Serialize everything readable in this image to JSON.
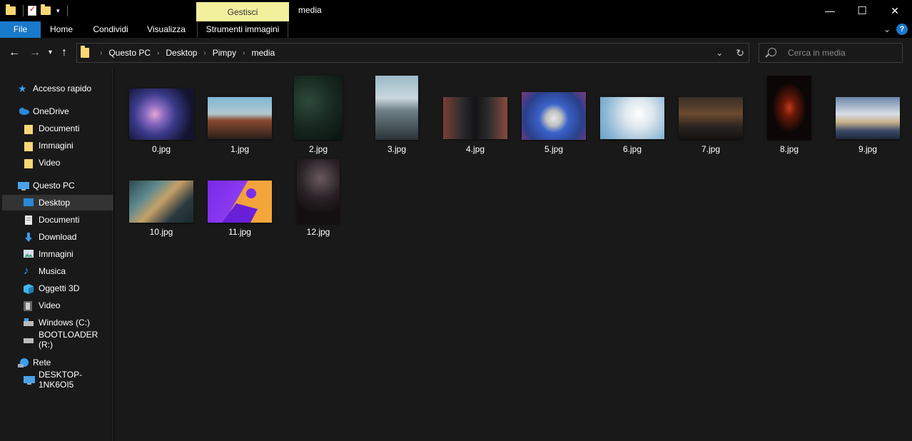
{
  "window": {
    "title": "media",
    "contextual_tab": "Gestisci",
    "minimize_glyph": "—",
    "maximize_glyph": "☐",
    "close_glyph": "✕"
  },
  "menu": {
    "file": "File",
    "home": "Home",
    "share": "Condividi",
    "view": "Visualizza",
    "image_tools": "Strumenti immagini"
  },
  "address": {
    "crumbs": [
      "Questo PC",
      "Desktop",
      "Pimpy",
      "media"
    ]
  },
  "search": {
    "placeholder": "Cerca in media"
  },
  "sidebar": {
    "items": [
      {
        "label": "Accesso rapido",
        "icon": "star-icon"
      },
      {
        "label": "OneDrive",
        "icon": "cloud-icon"
      },
      {
        "label": "Documenti",
        "icon": "folder-icon"
      },
      {
        "label": "Immagini",
        "icon": "folder-icon"
      },
      {
        "label": "Video",
        "icon": "folder-icon"
      },
      {
        "label": "Questo PC",
        "icon": "computer-icon"
      },
      {
        "label": "Desktop",
        "icon": "desktop-icon"
      },
      {
        "label": "Documenti",
        "icon": "documents-icon"
      },
      {
        "label": "Download",
        "icon": "download-icon"
      },
      {
        "label": "Immagini",
        "icon": "pictures-icon"
      },
      {
        "label": "Musica",
        "icon": "music-icon"
      },
      {
        "label": "Oggetti 3D",
        "icon": "cube-icon"
      },
      {
        "label": "Video",
        "icon": "video-icon"
      },
      {
        "label": "Windows (C:)",
        "icon": "drive-icon"
      },
      {
        "label": "BOOTLOADER (R:)",
        "icon": "drive-icon"
      },
      {
        "label": "Rete",
        "icon": "network-icon"
      },
      {
        "label": "DESKTOP-1NK6OI5",
        "icon": "computer-icon"
      }
    ],
    "selected": "Desktop"
  },
  "files": [
    {
      "name": "0.jpg"
    },
    {
      "name": "1.jpg"
    },
    {
      "name": "2.jpg"
    },
    {
      "name": "3.jpg"
    },
    {
      "name": "4.jpg"
    },
    {
      "name": "5.jpg"
    },
    {
      "name": "6.jpg"
    },
    {
      "name": "7.jpg"
    },
    {
      "name": "8.jpg"
    },
    {
      "name": "9.jpg"
    },
    {
      "name": "10.jpg"
    },
    {
      "name": "11.jpg"
    },
    {
      "name": "12.jpg"
    }
  ],
  "colors": {
    "accent": "#1979ca",
    "context_tab": "#f2ef9d",
    "background": "#191919"
  }
}
